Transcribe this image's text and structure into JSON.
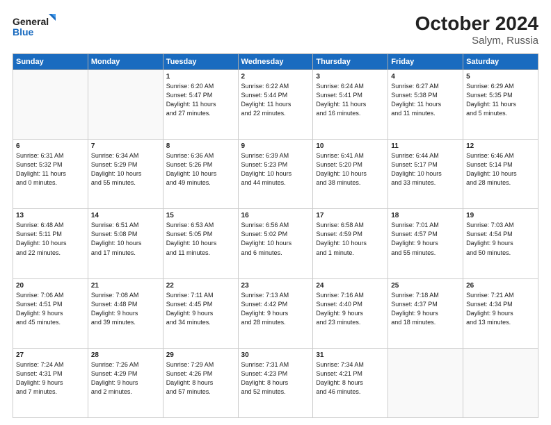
{
  "header": {
    "logo_line1": "General",
    "logo_line2": "Blue",
    "title": "October 2024",
    "subtitle": "Salym, Russia"
  },
  "weekdays": [
    "Sunday",
    "Monday",
    "Tuesday",
    "Wednesday",
    "Thursday",
    "Friday",
    "Saturday"
  ],
  "weeks": [
    [
      {
        "day": "",
        "detail": ""
      },
      {
        "day": "",
        "detail": ""
      },
      {
        "day": "1",
        "detail": "Sunrise: 6:20 AM\nSunset: 5:47 PM\nDaylight: 11 hours\nand 27 minutes."
      },
      {
        "day": "2",
        "detail": "Sunrise: 6:22 AM\nSunset: 5:44 PM\nDaylight: 11 hours\nand 22 minutes."
      },
      {
        "day": "3",
        "detail": "Sunrise: 6:24 AM\nSunset: 5:41 PM\nDaylight: 11 hours\nand 16 minutes."
      },
      {
        "day": "4",
        "detail": "Sunrise: 6:27 AM\nSunset: 5:38 PM\nDaylight: 11 hours\nand 11 minutes."
      },
      {
        "day": "5",
        "detail": "Sunrise: 6:29 AM\nSunset: 5:35 PM\nDaylight: 11 hours\nand 5 minutes."
      }
    ],
    [
      {
        "day": "6",
        "detail": "Sunrise: 6:31 AM\nSunset: 5:32 PM\nDaylight: 11 hours\nand 0 minutes."
      },
      {
        "day": "7",
        "detail": "Sunrise: 6:34 AM\nSunset: 5:29 PM\nDaylight: 10 hours\nand 55 minutes."
      },
      {
        "day": "8",
        "detail": "Sunrise: 6:36 AM\nSunset: 5:26 PM\nDaylight: 10 hours\nand 49 minutes."
      },
      {
        "day": "9",
        "detail": "Sunrise: 6:39 AM\nSunset: 5:23 PM\nDaylight: 10 hours\nand 44 minutes."
      },
      {
        "day": "10",
        "detail": "Sunrise: 6:41 AM\nSunset: 5:20 PM\nDaylight: 10 hours\nand 38 minutes."
      },
      {
        "day": "11",
        "detail": "Sunrise: 6:44 AM\nSunset: 5:17 PM\nDaylight: 10 hours\nand 33 minutes."
      },
      {
        "day": "12",
        "detail": "Sunrise: 6:46 AM\nSunset: 5:14 PM\nDaylight: 10 hours\nand 28 minutes."
      }
    ],
    [
      {
        "day": "13",
        "detail": "Sunrise: 6:48 AM\nSunset: 5:11 PM\nDaylight: 10 hours\nand 22 minutes."
      },
      {
        "day": "14",
        "detail": "Sunrise: 6:51 AM\nSunset: 5:08 PM\nDaylight: 10 hours\nand 17 minutes."
      },
      {
        "day": "15",
        "detail": "Sunrise: 6:53 AM\nSunset: 5:05 PM\nDaylight: 10 hours\nand 11 minutes."
      },
      {
        "day": "16",
        "detail": "Sunrise: 6:56 AM\nSunset: 5:02 PM\nDaylight: 10 hours\nand 6 minutes."
      },
      {
        "day": "17",
        "detail": "Sunrise: 6:58 AM\nSunset: 4:59 PM\nDaylight: 10 hours\nand 1 minute."
      },
      {
        "day": "18",
        "detail": "Sunrise: 7:01 AM\nSunset: 4:57 PM\nDaylight: 9 hours\nand 55 minutes."
      },
      {
        "day": "19",
        "detail": "Sunrise: 7:03 AM\nSunset: 4:54 PM\nDaylight: 9 hours\nand 50 minutes."
      }
    ],
    [
      {
        "day": "20",
        "detail": "Sunrise: 7:06 AM\nSunset: 4:51 PM\nDaylight: 9 hours\nand 45 minutes."
      },
      {
        "day": "21",
        "detail": "Sunrise: 7:08 AM\nSunset: 4:48 PM\nDaylight: 9 hours\nand 39 minutes."
      },
      {
        "day": "22",
        "detail": "Sunrise: 7:11 AM\nSunset: 4:45 PM\nDaylight: 9 hours\nand 34 minutes."
      },
      {
        "day": "23",
        "detail": "Sunrise: 7:13 AM\nSunset: 4:42 PM\nDaylight: 9 hours\nand 28 minutes."
      },
      {
        "day": "24",
        "detail": "Sunrise: 7:16 AM\nSunset: 4:40 PM\nDaylight: 9 hours\nand 23 minutes."
      },
      {
        "day": "25",
        "detail": "Sunrise: 7:18 AM\nSunset: 4:37 PM\nDaylight: 9 hours\nand 18 minutes."
      },
      {
        "day": "26",
        "detail": "Sunrise: 7:21 AM\nSunset: 4:34 PM\nDaylight: 9 hours\nand 13 minutes."
      }
    ],
    [
      {
        "day": "27",
        "detail": "Sunrise: 7:24 AM\nSunset: 4:31 PM\nDaylight: 9 hours\nand 7 minutes."
      },
      {
        "day": "28",
        "detail": "Sunrise: 7:26 AM\nSunset: 4:29 PM\nDaylight: 9 hours\nand 2 minutes."
      },
      {
        "day": "29",
        "detail": "Sunrise: 7:29 AM\nSunset: 4:26 PM\nDaylight: 8 hours\nand 57 minutes."
      },
      {
        "day": "30",
        "detail": "Sunrise: 7:31 AM\nSunset: 4:23 PM\nDaylight: 8 hours\nand 52 minutes."
      },
      {
        "day": "31",
        "detail": "Sunrise: 7:34 AM\nSunset: 4:21 PM\nDaylight: 8 hours\nand 46 minutes."
      },
      {
        "day": "",
        "detail": ""
      },
      {
        "day": "",
        "detail": ""
      }
    ]
  ]
}
